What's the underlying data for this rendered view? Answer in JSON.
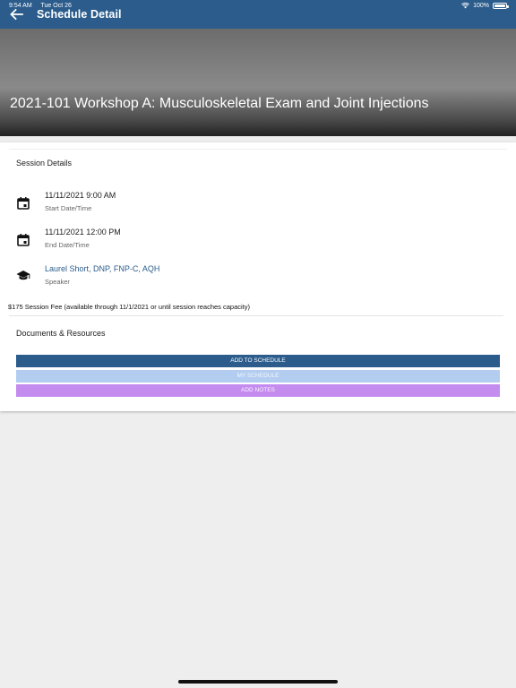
{
  "status_bar": {
    "time": "9:54 AM",
    "date": "Tue Oct 26",
    "battery": "100%"
  },
  "header": {
    "title": "Schedule Detail",
    "background": "#2b5c8c"
  },
  "hero": {
    "title": "2021-101 Workshop A: Musculoskeletal Exam and Joint Injections"
  },
  "session_details": {
    "heading": "Session Details",
    "rows": [
      {
        "icon": "calendar-icon",
        "value": "11/11/2021 9:00 AM",
        "label": "Start Date/Time"
      },
      {
        "icon": "calendar-icon",
        "value": "11/11/2021 12:00 PM",
        "label": "End Date/Time"
      },
      {
        "icon": "graduation-cap-icon",
        "value": "Laurel Short, DNP, FNP-C, AQH",
        "label": "Speaker"
      }
    ],
    "fee": "$175 Session Fee (available through 11/1/2021 or until session reaches capacity)"
  },
  "documents": {
    "heading": "Documents & Resources"
  },
  "buttons": {
    "add_to_schedule": "ADD TO SCHEDULE",
    "my_schedule": "MY SCHEDULE",
    "add_notes": "ADD NOTES"
  }
}
